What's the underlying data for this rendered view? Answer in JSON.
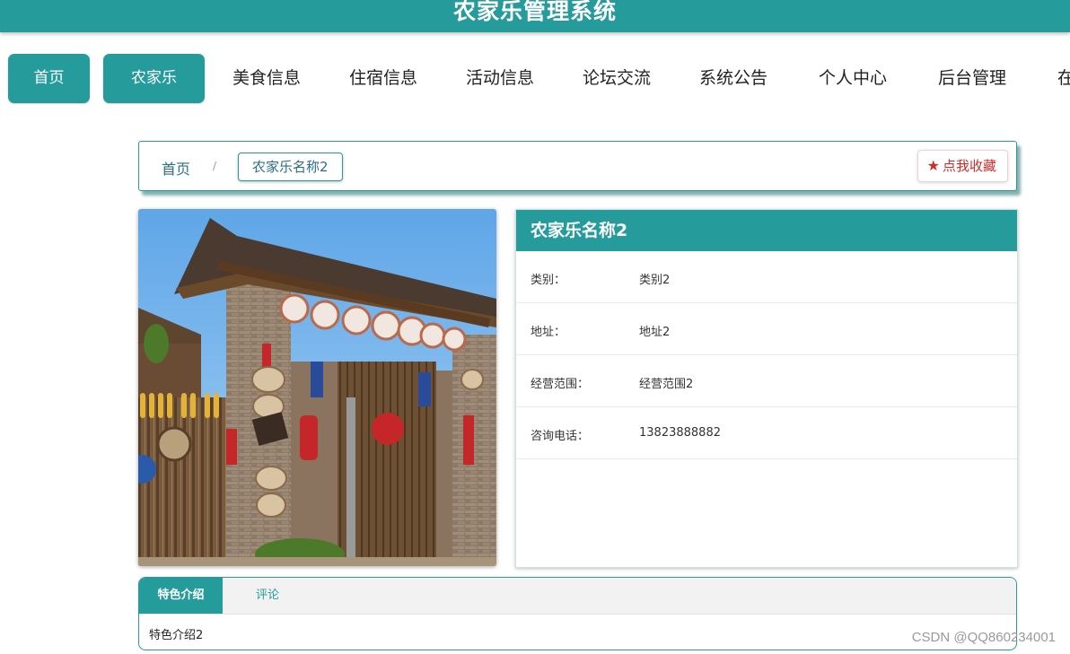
{
  "header": {
    "title": "农家乐管理系统"
  },
  "nav": {
    "items": [
      {
        "label": "首页"
      },
      {
        "label": "农家乐"
      },
      {
        "label": "美食信息"
      },
      {
        "label": "住宿信息"
      },
      {
        "label": "活动信息"
      },
      {
        "label": "论坛交流"
      },
      {
        "label": "系统公告"
      },
      {
        "label": "个人中心"
      },
      {
        "label": "后台管理"
      },
      {
        "label": "在"
      }
    ]
  },
  "breadcrumb": {
    "home": "首页",
    "separator": "/",
    "current": "农家乐名称2"
  },
  "favorite": {
    "icon": "star-icon",
    "label": "点我收藏"
  },
  "detail": {
    "title": "农家乐名称2",
    "fields": [
      {
        "key": "类别：",
        "value": "类别2"
      },
      {
        "key": "地址：",
        "value": "地址2"
      },
      {
        "key": "经营范围：",
        "value": "经营范围2"
      },
      {
        "key": "咨询电话：",
        "value": "13823888882"
      }
    ]
  },
  "tabs": {
    "active": "特色介绍",
    "other": "评论",
    "content": "特色介绍2"
  },
  "watermark": "CSDN @QQ860234001",
  "colors": {
    "accent": "#269b9b",
    "favorite": "#d62a2a"
  }
}
